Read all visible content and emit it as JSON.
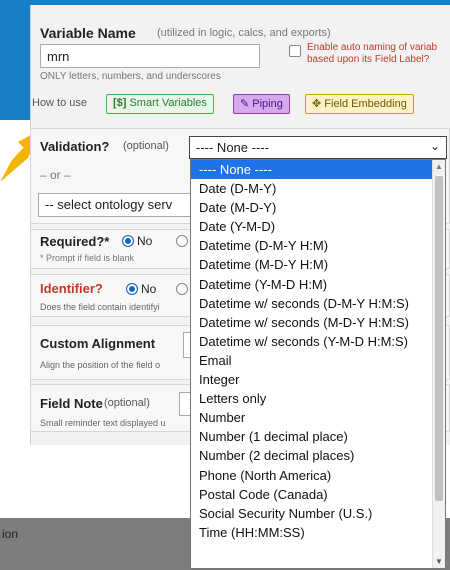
{
  "variable": {
    "title": "Variable Name",
    "hint": "(utilized in logic, calcs, and exports)",
    "value": "mrn",
    "help": "ONLY letters, numbers, and underscores",
    "auto_naming": "Enable auto naming of variab based upon its Field Label?"
  },
  "howto": {
    "label": "How to use",
    "smart_icon": "[$]",
    "smart_label": "Smart Variables",
    "piping_label": "Piping",
    "embed_label": "Field Embedding"
  },
  "validation": {
    "label": "Validation?",
    "optional": "(optional)",
    "selected": "---- None ----",
    "or_text": "– or –",
    "ontology_placeholder": "-- select ontology serv",
    "options": [
      "---- None ----",
      "Date (D-M-Y)",
      "Date (M-D-Y)",
      "Date (Y-M-D)",
      "Datetime (D-M-Y H:M)",
      "Datetime (M-D-Y H:M)",
      "Datetime (Y-M-D H:M)",
      "Datetime w/ seconds (D-M-Y H:M:S)",
      "Datetime w/ seconds (M-D-Y H:M:S)",
      "Datetime w/ seconds (Y-M-D H:M:S)",
      "Email",
      "Integer",
      "Letters only",
      "Number",
      "Number (1 decimal place)",
      "Number (2 decimal places)",
      "Phone (North America)",
      "Postal Code (Canada)",
      "Social Security Number (U.S.)",
      "Time (HH:MM:SS)"
    ]
  },
  "required": {
    "label": "Required?*",
    "no_label": "No",
    "help": "* Prompt if field is blank"
  },
  "identifier": {
    "label": "Identifier?",
    "no_label": "No",
    "help": "Does the field contain identifyi"
  },
  "alignment": {
    "label": "Custom Alignment",
    "help": "Align the position of the field o"
  },
  "field_note": {
    "label": "Field Note",
    "optional": "(optional)",
    "help": "Small reminder text displayed u"
  },
  "footer": {
    "text": "ion"
  },
  "colors": {
    "accent_blue": "#1a7fc9",
    "selected_option": "#1e73e8",
    "identifier_red": "#c0392b",
    "arrow": "#f5b400"
  }
}
